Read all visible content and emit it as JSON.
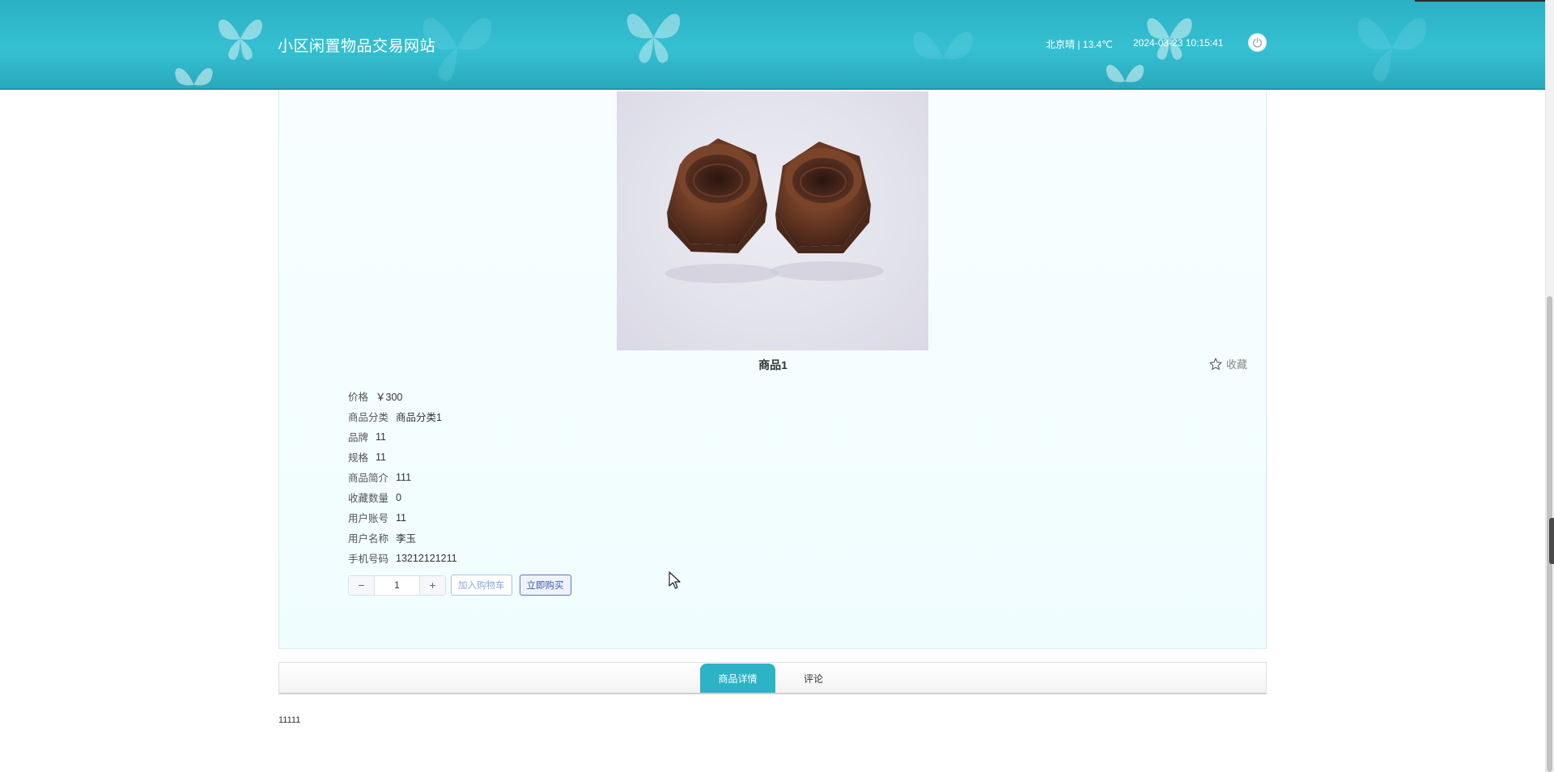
{
  "header": {
    "site_title": "小区闲置物品交易网站",
    "weather": "北京晴 | 13.4℃",
    "datetime": "2024-03-23   10:15:41",
    "power_icon": "power-icon",
    "colors": {
      "header_bg": "#35c0d2",
      "accent": "#2cb3c6"
    }
  },
  "product": {
    "image_alt": "two copper hex nuts",
    "name": "商品1",
    "favorite_label": "收藏",
    "favorite_icon": "star-outline-icon",
    "info": [
      {
        "label": "价格",
        "value": "￥300"
      },
      {
        "label": "商品分类",
        "value": "商品分类1"
      },
      {
        "label": "品牌",
        "value": "11"
      },
      {
        "label": "规格",
        "value": "11"
      },
      {
        "label": "商品简介",
        "value": "111"
      },
      {
        "label": "收藏数量",
        "value": "0"
      },
      {
        "label": "用户账号",
        "value": "11"
      },
      {
        "label": "用户名称",
        "value": "李玉"
      },
      {
        "label": "手机号码",
        "value": "13212121211"
      }
    ],
    "quantity": {
      "minus": "−",
      "value": "1",
      "plus": "+"
    },
    "add_to_cart_label": "加入购物车",
    "buy_now_label": "立即购买"
  },
  "tabs": [
    {
      "label": "商品详情",
      "active": true
    },
    {
      "label": "评论",
      "active": false
    }
  ],
  "detail": {
    "text": "11111"
  }
}
